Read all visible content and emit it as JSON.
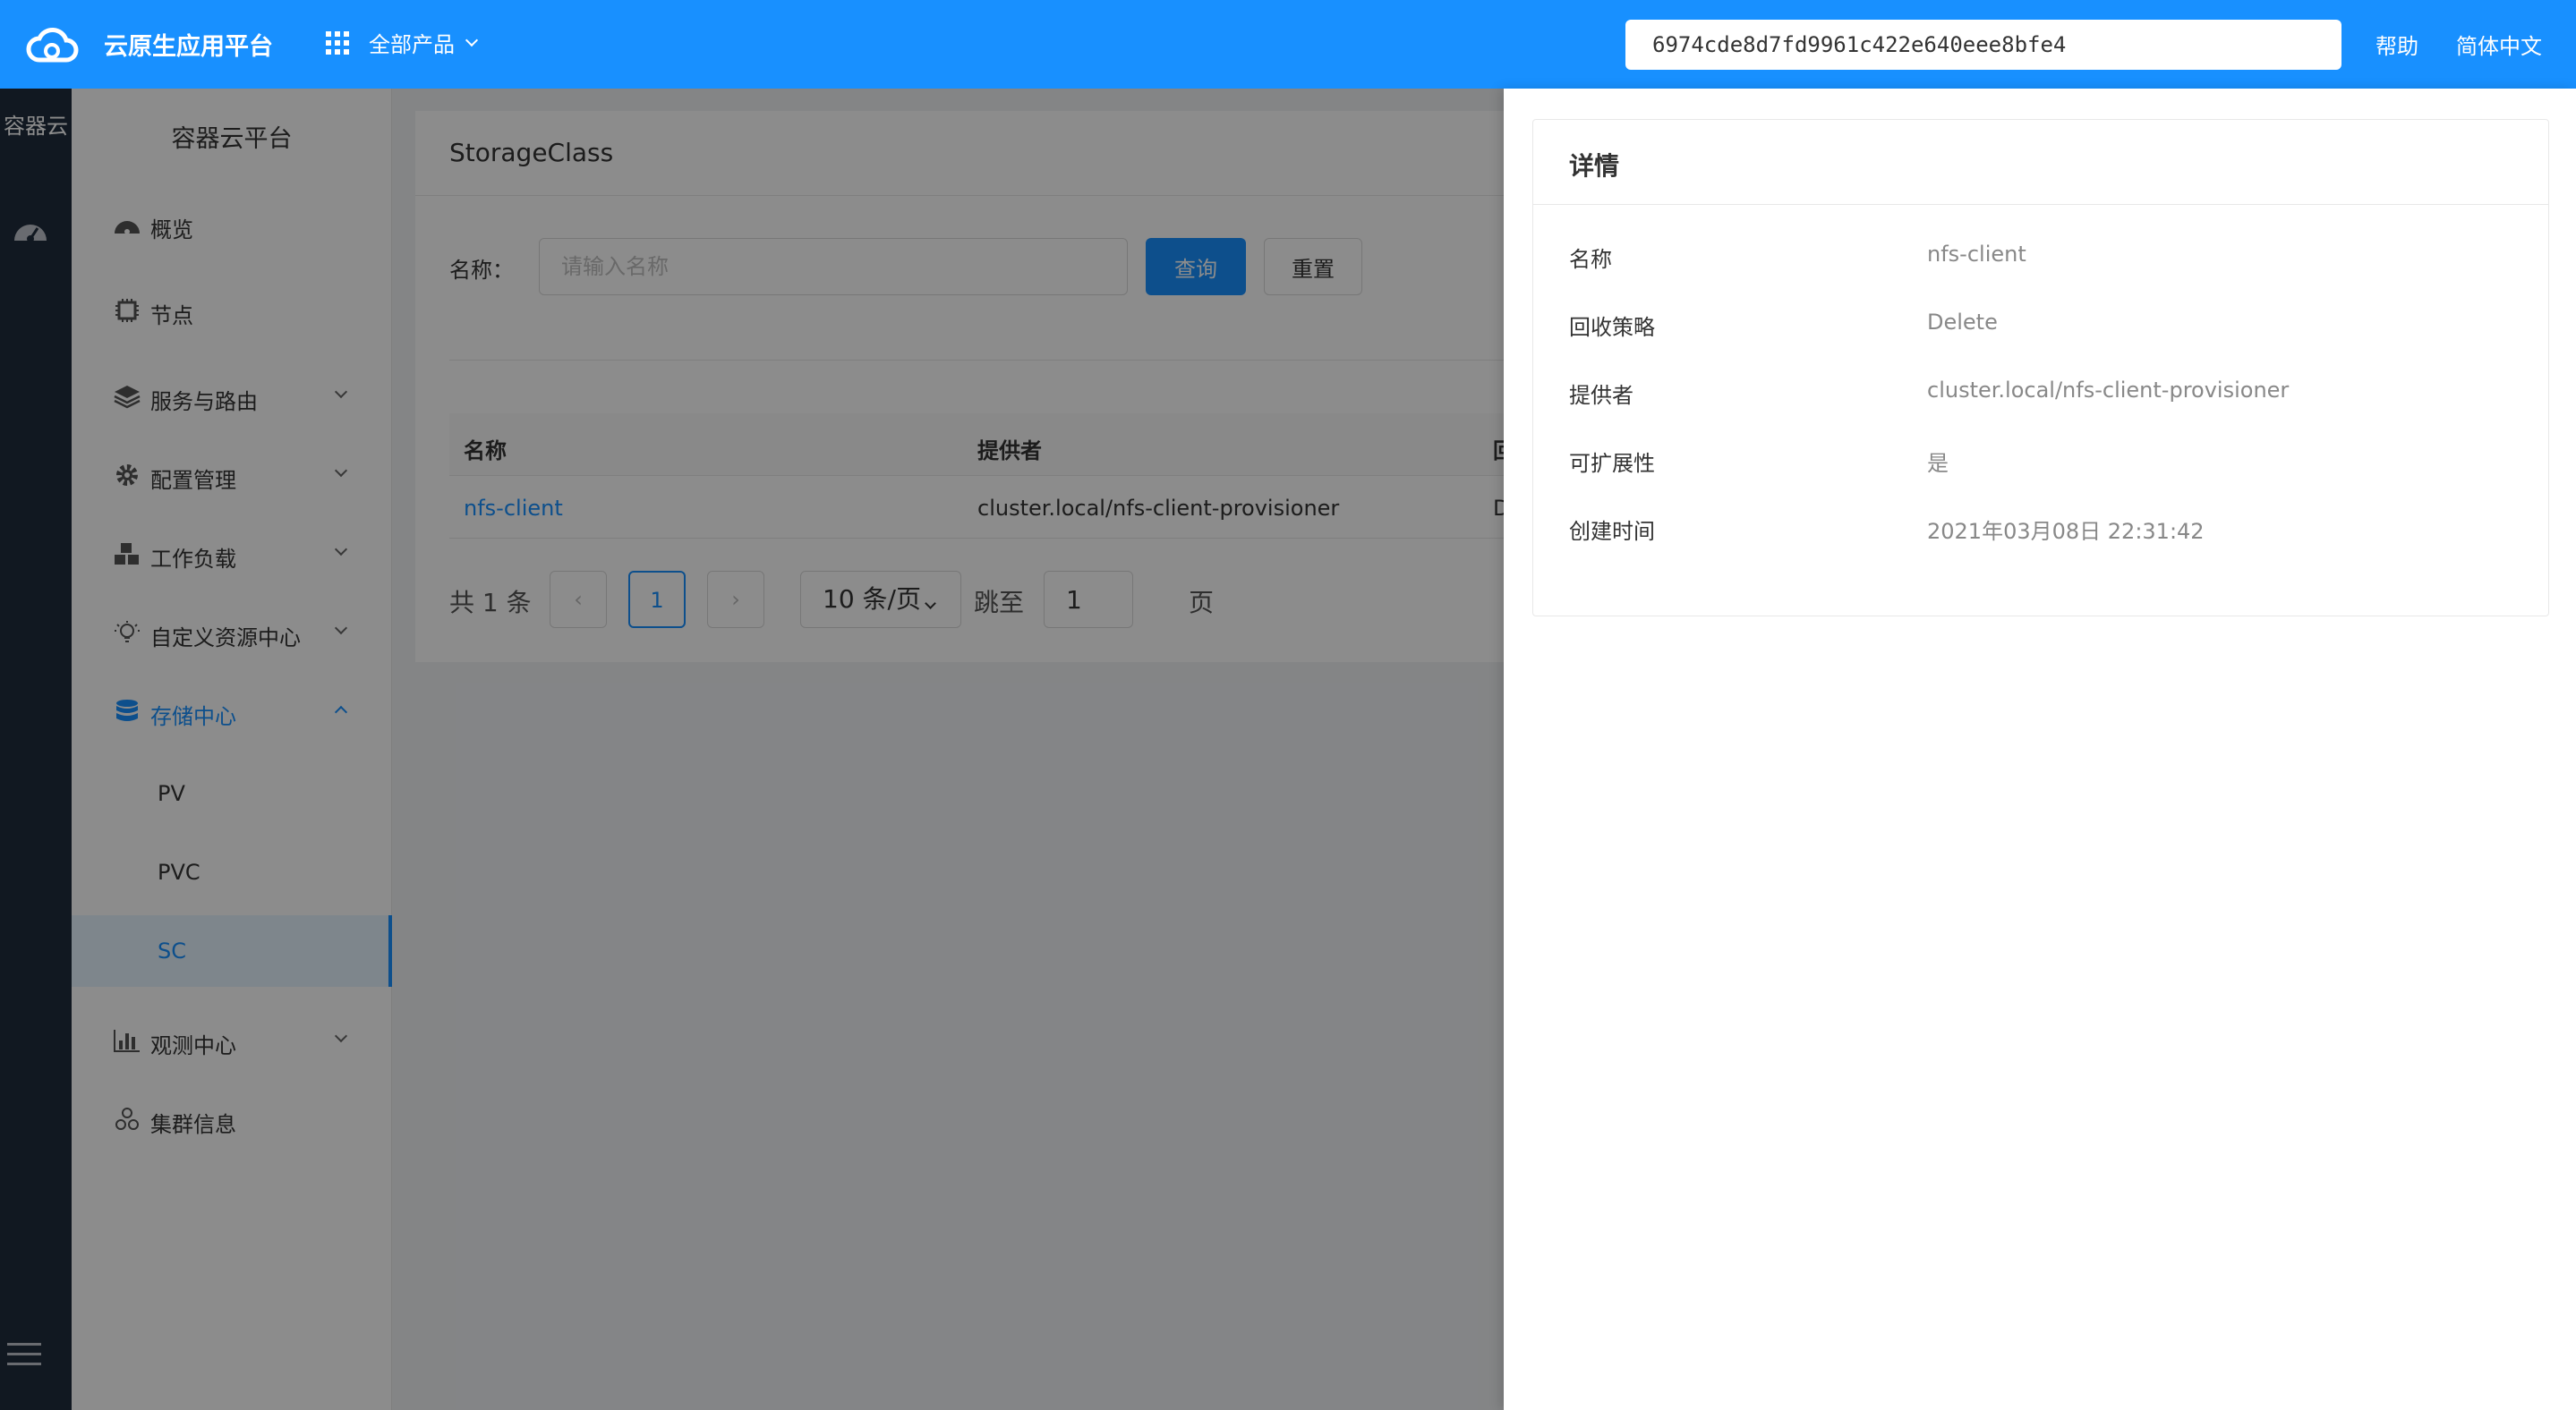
{
  "header": {
    "app_title": "云原生应用平台",
    "products_label": "全部产品",
    "search_value": "6974cde8d7fd9961c422e640eee8bfe4",
    "help_label": "帮助",
    "lang_label": "简体中文",
    "brand_color": "#1890ff"
  },
  "rail": {
    "label": "容器云",
    "icons": [
      "dashboard-icon",
      "menu-icon"
    ]
  },
  "sidebar": {
    "title": "容器云平台",
    "items": [
      {
        "label": "概览",
        "icon": "dashboard-icon"
      },
      {
        "label": "节点",
        "icon": "chip-icon"
      },
      {
        "label": "服务与路由",
        "icon": "layers-icon"
      },
      {
        "label": "配置管理",
        "icon": "gear-icon"
      },
      {
        "label": "工作负载",
        "icon": "cubes-icon"
      },
      {
        "label": "自定义资源中心",
        "icon": "lightbulb-icon"
      },
      {
        "label": "存储中心",
        "icon": "database-icon"
      },
      {
        "label": "观测中心",
        "icon": "bar-chart-icon"
      },
      {
        "label": "集群信息",
        "icon": "cluster-icon"
      }
    ],
    "storage_sub": [
      "PV",
      "PVC",
      "SC"
    ]
  },
  "main": {
    "title": "StorageClass",
    "filter_label": "名称：",
    "filter_placeholder": "请输入名称",
    "query_label": "查询",
    "reset_label": "重置",
    "columns": [
      "名称",
      "提供者",
      "回"
    ],
    "rows": [
      {
        "name": "nfs-client",
        "provisioner": "cluster.local/nfs-client-provisioner",
        "reclaim": "De"
      }
    ],
    "pagination": {
      "total": "共 1 条",
      "prev": "‹",
      "current": "1",
      "next": "›",
      "page_size": "10 条/页",
      "goto_label": "跳至",
      "goto_value": "1",
      "page_label": "页"
    }
  },
  "drawer": {
    "title": "详情",
    "fields": [
      {
        "key": "名称",
        "value": "nfs-client"
      },
      {
        "key": "回收策略",
        "value": "Delete"
      },
      {
        "key": "提供者",
        "value": "cluster.local/nfs-client-provisioner"
      },
      {
        "key": "可扩展性",
        "value": "是"
      },
      {
        "key": "创建时间",
        "value": "2021年03月08日 22:31:42"
      }
    ]
  }
}
